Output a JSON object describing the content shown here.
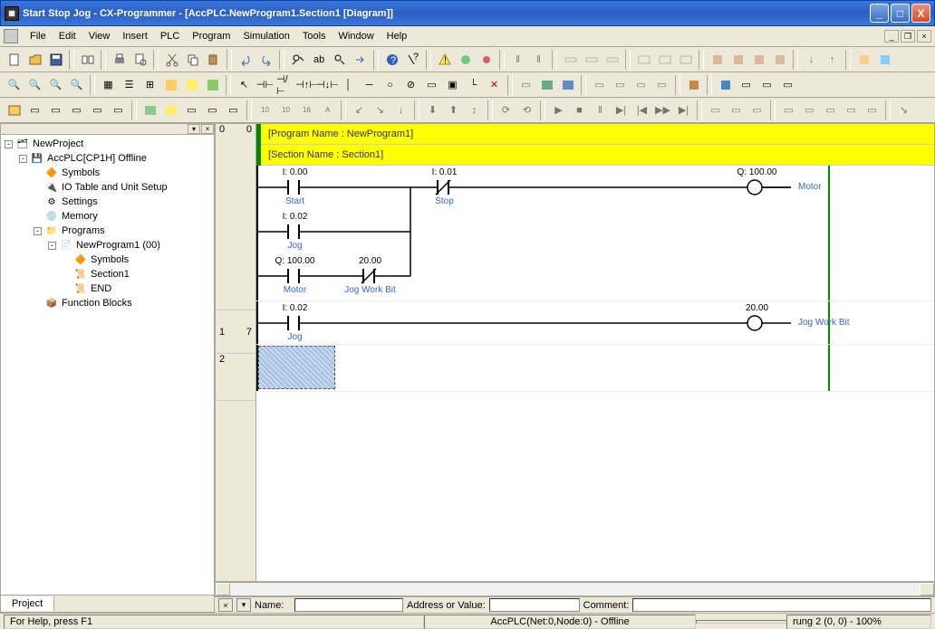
{
  "titlebar": {
    "title": "Start Stop Jog - CX-Programmer - [AccPLC.NewProgram1.Section1 [Diagram]]"
  },
  "menu": {
    "file": "File",
    "edit": "Edit",
    "view": "View",
    "insert": "Insert",
    "plc": "PLC",
    "program": "Program",
    "simulation": "Simulation",
    "tools": "Tools",
    "window": "Window",
    "help": "Help"
  },
  "tree": {
    "root": "NewProject",
    "plc": "AccPLC[CP1H] Offline",
    "symbols": "Symbols",
    "iotable": "IO Table and Unit Setup",
    "settings": "Settings",
    "memory": "Memory",
    "programs": "Programs",
    "newprogram": "NewProgram1 (00)",
    "prog_symbols": "Symbols",
    "section1": "Section1",
    "end": "END",
    "function_blocks": "Function Blocks"
  },
  "sidebar_tab": "Project",
  "header": {
    "program_name": "[Program Name : NewProgram1]",
    "section_name": "[Section Name : Section1]"
  },
  "rung0": {
    "gutter": "0",
    "step": "0",
    "c1_addr": "I: 0.00",
    "c1_name": "Start",
    "c2_addr": "I: 0.01",
    "c2_name": "Stop",
    "coil_addr": "Q: 100.00",
    "coil_name": "Motor",
    "b2_c1_addr": "I: 0.02",
    "b2_c1_name": "Jog",
    "b3_c1_addr": "Q: 100.00",
    "b3_c1_name": "Motor",
    "b3_c2_addr": "20.00",
    "b3_c2_name": "Jog Work Bit"
  },
  "rung1": {
    "gutter": "1",
    "step": "7",
    "c1_addr": "I: 0.02",
    "c1_name": "Jog",
    "coil_addr": "20.00",
    "coil_name": "Jog Work Bit"
  },
  "rung2": {
    "gutter": "2"
  },
  "detail": {
    "name_lbl": "Name:",
    "addr_lbl": "Address or Value:",
    "comment_lbl": "Comment:"
  },
  "status": {
    "help": "For Help, press F1",
    "plc": "AccPLC(Net:0,Node:0) - Offline",
    "rung": "rung 2 (0, 0) - 100%"
  }
}
